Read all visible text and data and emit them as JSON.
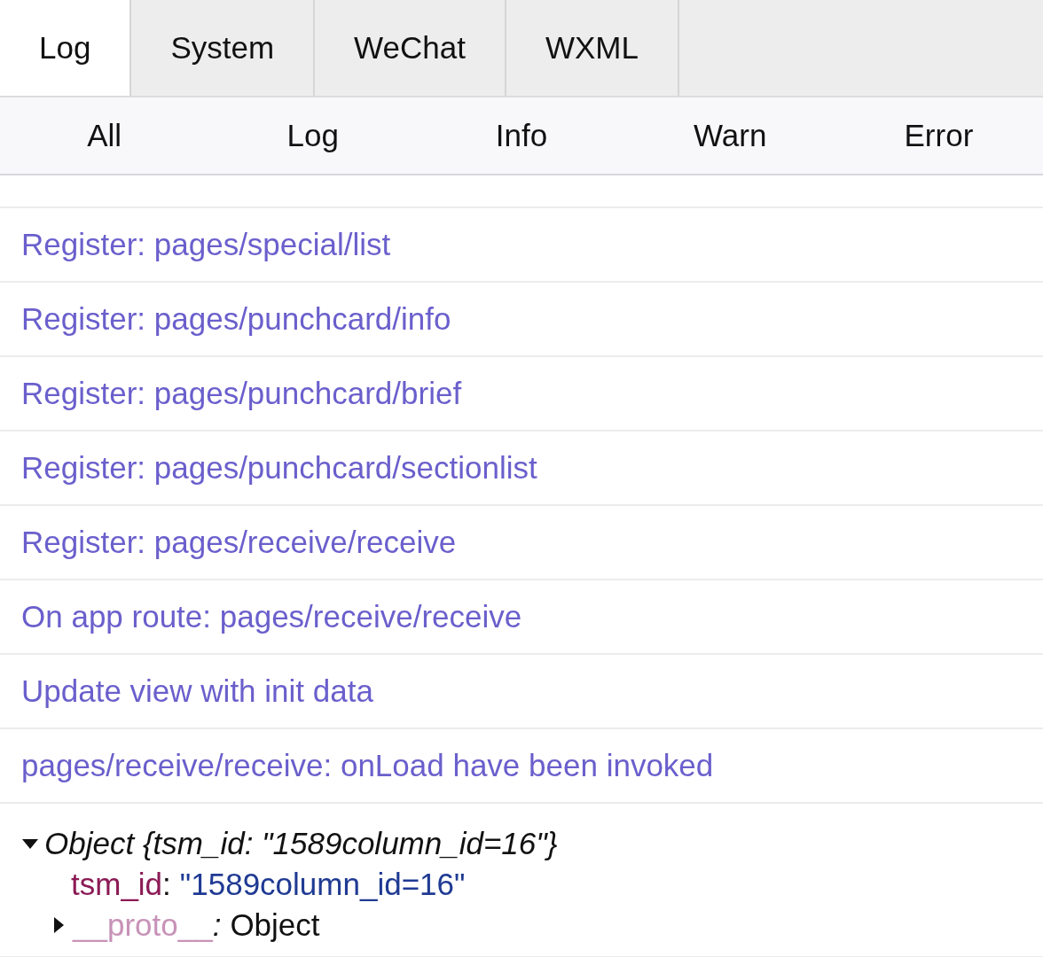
{
  "tabs": [
    {
      "label": "Log",
      "selected": true
    },
    {
      "label": "System",
      "selected": false
    },
    {
      "label": "WeChat",
      "selected": false
    },
    {
      "label": "WXML",
      "selected": false
    }
  ],
  "filters": [
    {
      "label": "All",
      "selected": false
    },
    {
      "label": "Log",
      "selected": false
    },
    {
      "label": "Info",
      "selected": false
    },
    {
      "label": "Warn",
      "selected": false
    },
    {
      "label": "Error",
      "selected": false
    }
  ],
  "logs": [
    {
      "kind": "text",
      "text": "Register: pages/special/list"
    },
    {
      "kind": "text",
      "text": "Register: pages/punchcard/info"
    },
    {
      "kind": "text",
      "text": "Register: pages/punchcard/brief"
    },
    {
      "kind": "text",
      "text": "Register: pages/punchcard/sectionlist"
    },
    {
      "kind": "text",
      "text": "Register: pages/receive/receive"
    },
    {
      "kind": "text",
      "text": "On app route: pages/receive/receive"
    },
    {
      "kind": "text",
      "text": "Update view with init data"
    },
    {
      "kind": "text",
      "text": "pages/receive/receive: onLoad have been invoked"
    },
    {
      "kind": "object",
      "summary": "Object {tsm_id: \"1589column_id=16\"}",
      "expanded": true,
      "properties": [
        {
          "key": "tsm_id",
          "separator": ":",
          "value": "\"1589column_id=16\""
        }
      ],
      "proto": {
        "key": "__proto__",
        "separator": ":",
        "value": "Object",
        "expanded": false
      }
    }
  ]
}
